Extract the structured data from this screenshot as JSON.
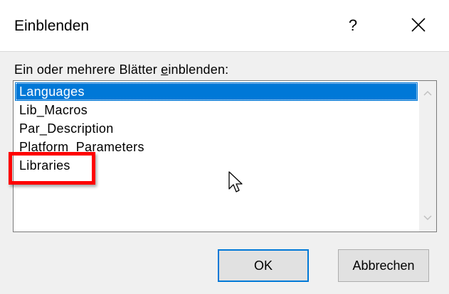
{
  "dialog": {
    "title": "Einblenden",
    "help_label": "?",
    "close_icon": "close-icon"
  },
  "prompt": {
    "before": "Ein oder mehrere Blätter ",
    "underlined": "e",
    "after": "inblenden:"
  },
  "list": {
    "items": [
      {
        "label": "Languages",
        "selected": true
      },
      {
        "label": "Lib_Macros",
        "selected": false
      },
      {
        "label": "Par_Description",
        "selected": false
      },
      {
        "label": "Platform_Parameters",
        "selected": false
      },
      {
        "label": "Libraries",
        "selected": false
      }
    ]
  },
  "annotation": {
    "highlight_color": "#ff0000",
    "highlighted_item": "Libraries"
  },
  "buttons": {
    "ok_label": "OK",
    "cancel_label": "Abbrechen"
  },
  "colors": {
    "selection": "#0078d7",
    "dialog_bg": "#f0f0f0"
  }
}
